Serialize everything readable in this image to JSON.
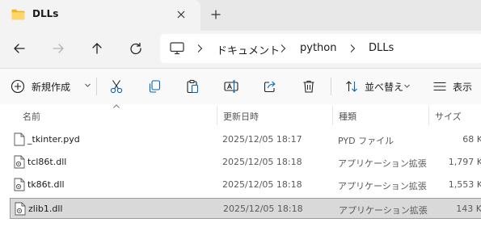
{
  "tab": {
    "title": "DLLs",
    "close_glyph": "✕",
    "new_tab_glyph": "+"
  },
  "nav": {
    "breadcrumb": [
      "ドキュメント",
      "python",
      "DLLs"
    ]
  },
  "toolbar": {
    "new_label": "新規作成",
    "sort_label": "並べ替え",
    "view_label": "表示"
  },
  "columns": {
    "name": "名前",
    "date": "更新日時",
    "type": "種類",
    "size": "サイズ"
  },
  "files": [
    {
      "name": "_tkinter.pyd",
      "date": "2025/12/05 18:17",
      "type": "PYD ファイル",
      "size": "68 K",
      "icon": "file-icon",
      "selected": false
    },
    {
      "name": "tcl86t.dll",
      "date": "2025/12/05 18:18",
      "type": "アプリケーション拡張",
      "size": "1,797 K",
      "icon": "dll-file-icon",
      "selected": false
    },
    {
      "name": "tk86t.dll",
      "date": "2025/12/05 18:18",
      "type": "アプリケーション拡張",
      "size": "1,553 K",
      "icon": "dll-file-icon",
      "selected": false
    },
    {
      "name": "zlib1.dll",
      "date": "2025/12/05 18:18",
      "type": "アプリケーション拡張",
      "size": "143 K",
      "icon": "dll-file-icon",
      "selected": true
    }
  ],
  "colors": {
    "folder": "#f0b429",
    "accent_blue": "#0067c0",
    "selection_bg": "#d9d9d9",
    "window_bg": "#f3f3f3"
  }
}
